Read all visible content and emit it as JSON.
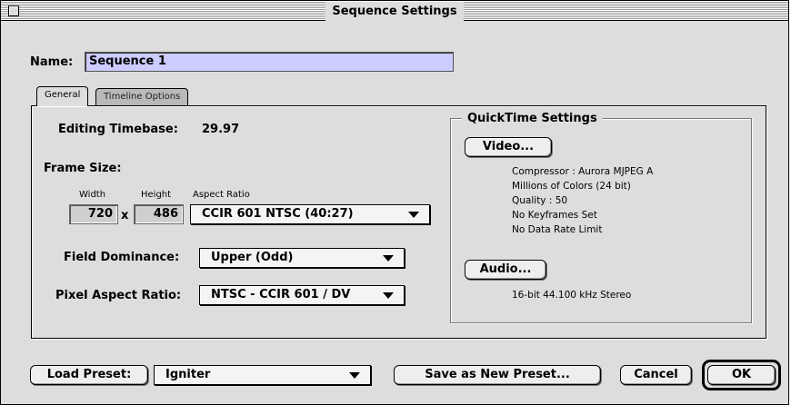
{
  "window": {
    "title": "Sequence Settings"
  },
  "name": {
    "label": "Name:",
    "value": "Sequence 1"
  },
  "tabs": [
    {
      "label": "General",
      "active": true
    },
    {
      "label": "Timeline Options",
      "active": false
    }
  ],
  "general": {
    "editing_timebase_label": "Editing Timebase:",
    "editing_timebase_value": "29.97",
    "frame_size_label": "Frame Size:",
    "width_label": "Width",
    "height_label": "Height",
    "aspect_ratio_label": "Aspect Ratio",
    "width_value": "720",
    "times_symbol": "x",
    "height_value": "486",
    "aspect_ratio_value": "CCIR 601 NTSC (40:27)",
    "field_dominance_label": "Field Dominance:",
    "field_dominance_value": "Upper (Odd)",
    "pixel_aspect_label": "Pixel Aspect Ratio:",
    "pixel_aspect_value": "NTSC - CCIR 601 / DV"
  },
  "quicktime": {
    "title": "QuickTime Settings",
    "video_button": "Video...",
    "video_info": [
      "Compressor : Aurora MJPEG A",
      "Millions of Colors (24 bit)",
      "Quality : 50",
      "No Keyframes Set",
      "No Data Rate Limit"
    ],
    "audio_button": "Audio...",
    "audio_info": "16-bit 44.100 kHz Stereo"
  },
  "footer": {
    "load_preset_button": "Load Preset:",
    "preset_value": "Igniter",
    "save_preset_button": "Save as New Preset...",
    "cancel_button": "Cancel",
    "ok_button": "OK"
  }
}
